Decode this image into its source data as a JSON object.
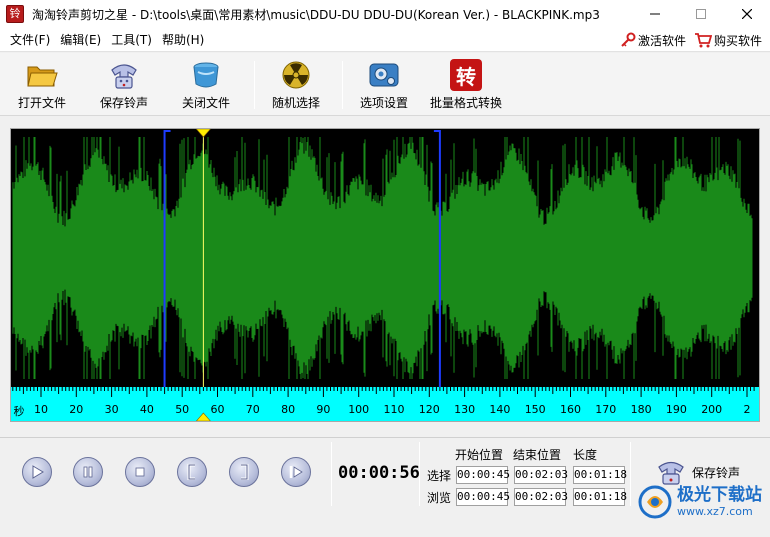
{
  "window": {
    "title": "淘淘铃声剪切之星 - D:\\tools\\桌面\\常用素材\\music\\DDU-DU DDU-DU(Korean Ver.) - BLACKPINK.mp3",
    "icon_char": "铃"
  },
  "menu": {
    "items": [
      "文件(F)",
      "编辑(E)",
      "工具(T)",
      "帮助(H)"
    ],
    "activate_label": "激活软件",
    "buy_label": "购买软件"
  },
  "toolbar": {
    "open_label": "打开文件",
    "save_label": "保存铃声",
    "close_label": "关闭文件",
    "random_label": "随机选择",
    "options_label": "选项设置",
    "convert_label": "批量格式转换",
    "convert_icon_char": "转"
  },
  "waveform": {
    "color": "#1a8a1a",
    "background": "#000000",
    "selection_start_sec": 45,
    "selection_end_sec": 123,
    "playhead_sec": 56,
    "ruler_unit": "秒",
    "ruler_labels": [
      "10",
      "20",
      "30",
      "40",
      "50",
      "60",
      "70",
      "80",
      "90",
      "100",
      "110",
      "120",
      "130",
      "140",
      "150",
      "160",
      "170",
      "180",
      "190",
      "200",
      "2"
    ],
    "ruler_color": "#00ffff"
  },
  "transport": {
    "current_time": "00:00:56"
  },
  "times": {
    "col_start": "开始位置",
    "col_end": "结束位置",
    "col_len": "长度",
    "row_select": "选择",
    "row_browse": "浏览",
    "select": {
      "start": "00:00:45",
      "end": "00:02:03",
      "len": "00:01:18"
    },
    "browse": {
      "start": "00:00:45",
      "end": "00:02:03",
      "len": "00:01:18"
    }
  },
  "save_ringtone_label": "保存铃声",
  "watermark": {
    "line1": "极光下载站",
    "line2": "www.xz7.com"
  }
}
